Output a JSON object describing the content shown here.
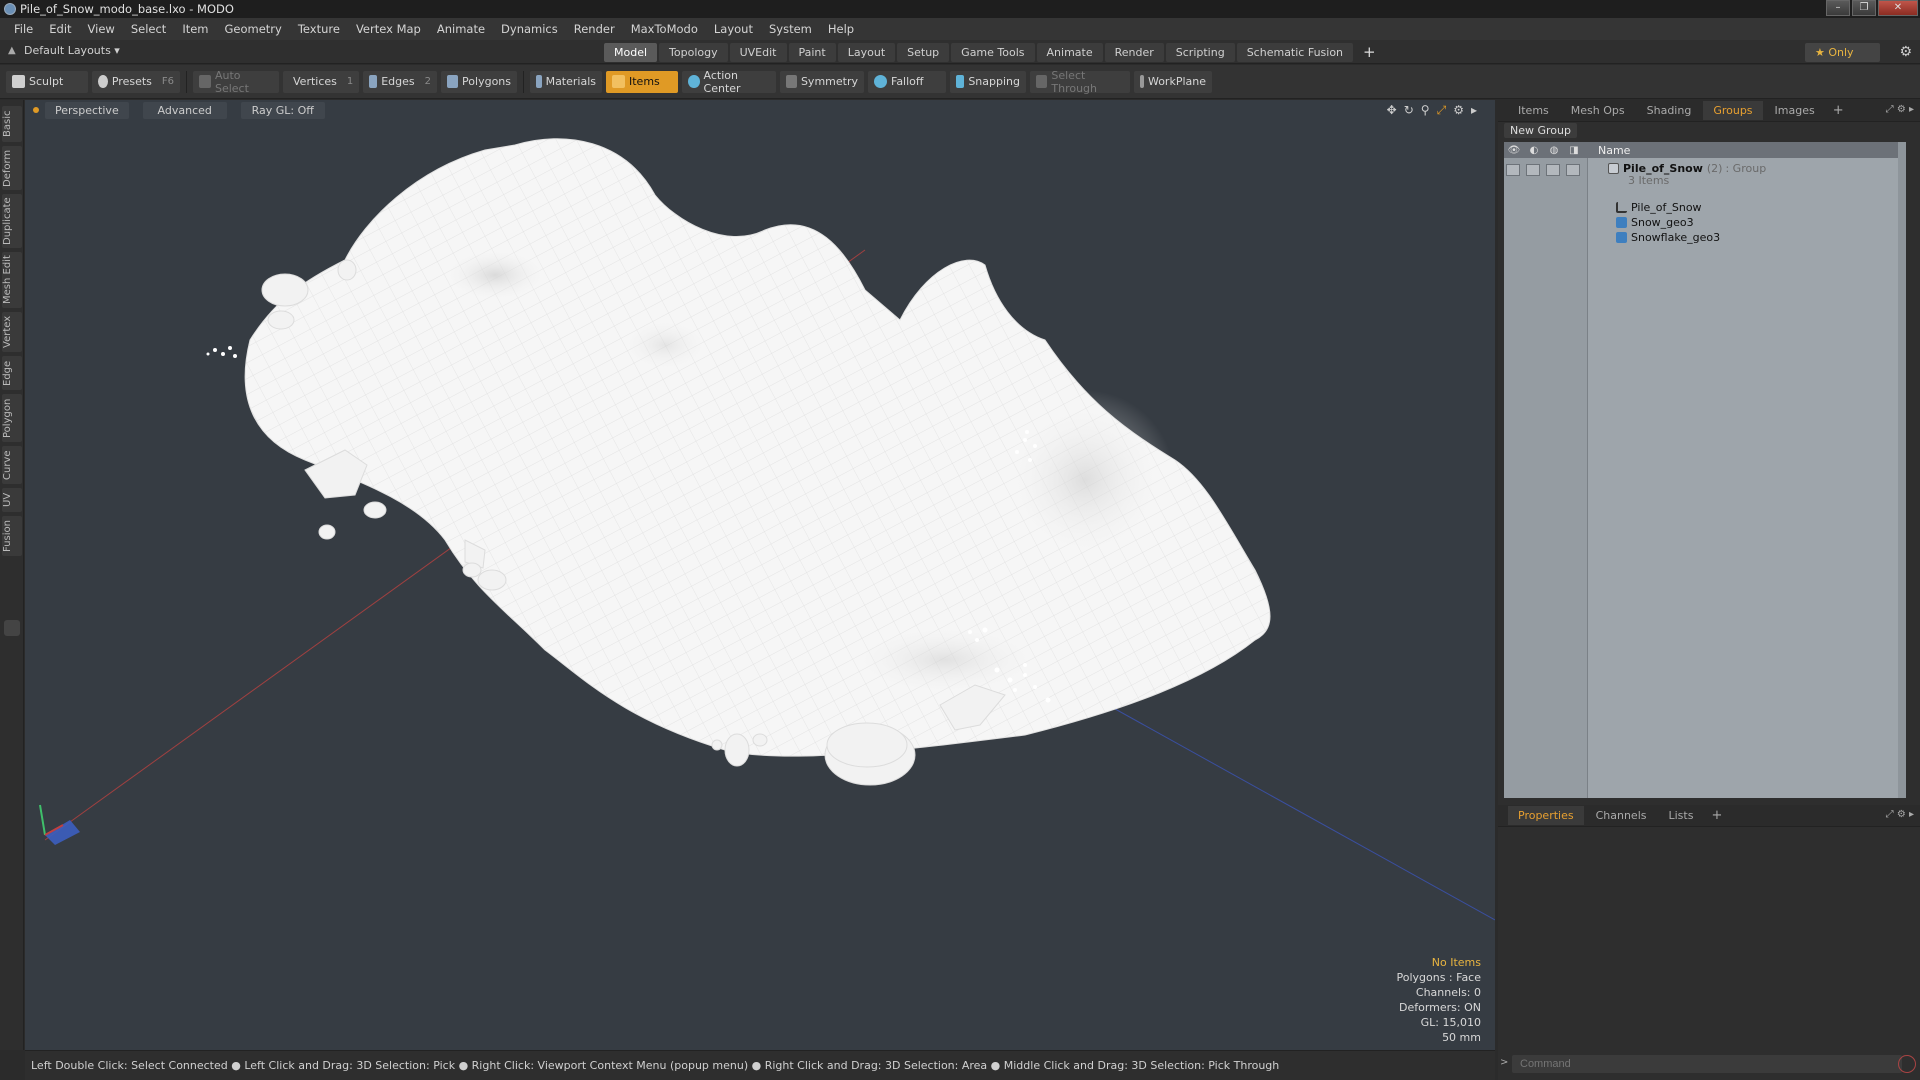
{
  "window": {
    "title": "Pile_of_Snow_modo_base.lxo - MODO"
  },
  "menu": [
    "File",
    "Edit",
    "View",
    "Select",
    "Item",
    "Geometry",
    "Texture",
    "Vertex Map",
    "Animate",
    "Dynamics",
    "Render",
    "MaxToModo",
    "Layout",
    "System",
    "Help"
  ],
  "layout": {
    "selector": "Default Layouts ▾",
    "tabs": [
      "Model",
      "Topology",
      "UVEdit",
      "Paint",
      "Layout",
      "Setup",
      "Game Tools",
      "Animate",
      "Render",
      "Scripting",
      "Schematic Fusion"
    ],
    "active_tab": "Model",
    "only_label": "★ Only"
  },
  "toolbar": {
    "sculpt": "Sculpt",
    "presets": "Presets",
    "presets_key": "F6",
    "auto_select": "Auto Select",
    "vertices": "Vertices",
    "vertices_key": "1",
    "edges": "Edges",
    "edges_key": "2",
    "polygons": "Polygons",
    "materials": "Materials",
    "items": "Items",
    "action_center": "Action Center",
    "symmetry": "Symmetry",
    "falloff": "Falloff",
    "snapping": "Snapping",
    "select_through": "Select Through",
    "workplane": "WorkPlane"
  },
  "left_tabs": [
    "Basic",
    "Deform",
    "Duplicate",
    "Mesh Edit",
    "Vertex",
    "Edge",
    "Polygon",
    "Curve",
    "UV",
    "Fusion"
  ],
  "viewport": {
    "view": "Perspective",
    "mode": "Advanced",
    "raygl": "Ray GL: Off",
    "hud": {
      "selection": "No Items",
      "polygons": "Polygons : Face",
      "channels": "Channels: 0",
      "deformers": "Deformers: ON",
      "gl": "GL: 15,010",
      "size": "50 mm"
    }
  },
  "status": "Left Double Click: Select Connected ● Left Click and Drag: 3D Selection: Pick ● Right Click: Viewport Context Menu (popup menu) ● Right Click and Drag: 3D Selection: Area ● Middle Click and Drag: 3D Selection: Pick Through",
  "groups_panel": {
    "tabs": [
      "Items",
      "Mesh Ops",
      "Shading",
      "Groups",
      "Images"
    ],
    "active_tab": "Groups",
    "new_group": "New Group",
    "column_name": "Name",
    "group": {
      "name": "Pile_of_Snow",
      "count": "(2)",
      "type": ": Group",
      "items_label": "3 Items"
    },
    "children": [
      "Pile_of_Snow",
      "Snow_geo3",
      "Snowflake_geo3"
    ]
  },
  "props_panel": {
    "tabs": [
      "Properties",
      "Channels",
      "Lists"
    ],
    "active_tab": "Properties",
    "command_placeholder": "Command"
  },
  "colors": {
    "accent": "#e09a25",
    "viewport_bg": "#363c43",
    "list_bg": "#9ea5ab"
  }
}
